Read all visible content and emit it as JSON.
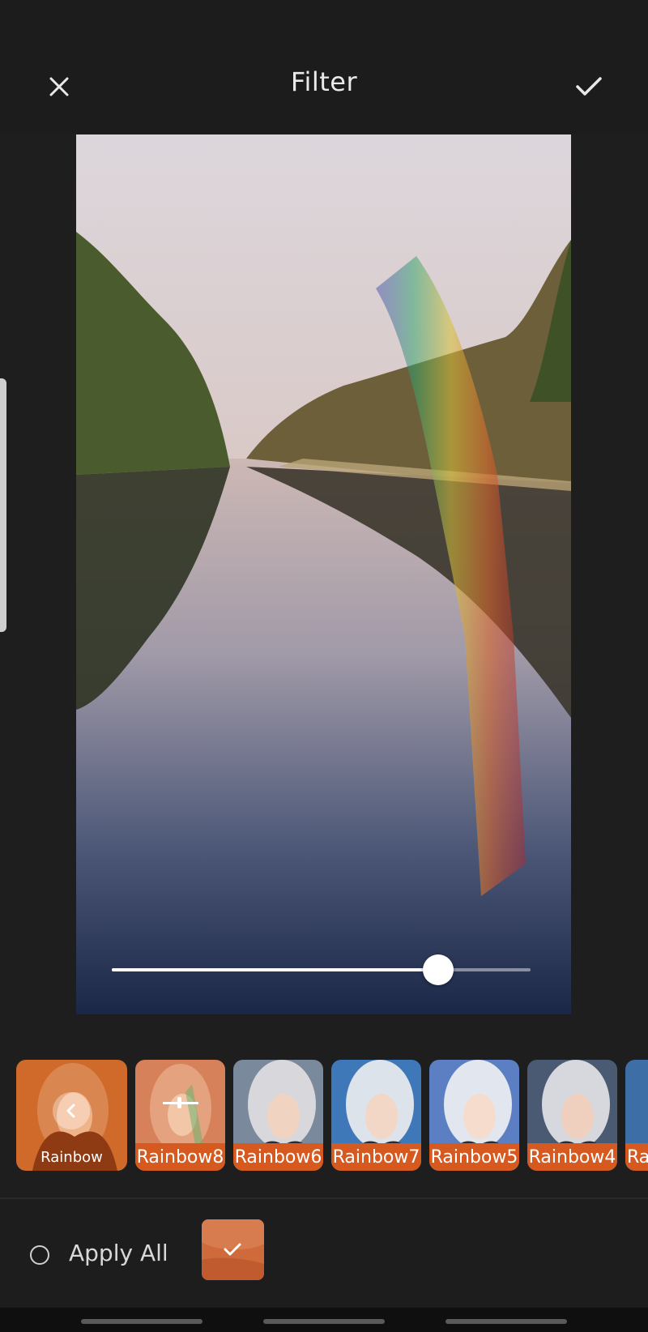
{
  "header": {
    "title": "Filter",
    "close_icon": "close-icon",
    "confirm_icon": "checkmark-icon"
  },
  "editor": {
    "intensity": 0.78
  },
  "filters": {
    "selected": "Rainbow",
    "items": [
      {
        "label": "Rainbow",
        "icon": "chevron-left-icon"
      },
      {
        "label": "Rainbow8",
        "icon": "adjust-slider-icon"
      },
      {
        "label": "Rainbow6"
      },
      {
        "label": "Rainbow7"
      },
      {
        "label": "Rainbow5"
      },
      {
        "label": "Rainbow4"
      },
      {
        "label": "Ra"
      }
    ]
  },
  "bottom": {
    "apply_all_label": "Apply All",
    "applied_icon": "checkmark-icon"
  },
  "colors": {
    "accent": "#d65a1f",
    "background": "#1e1e1f"
  }
}
